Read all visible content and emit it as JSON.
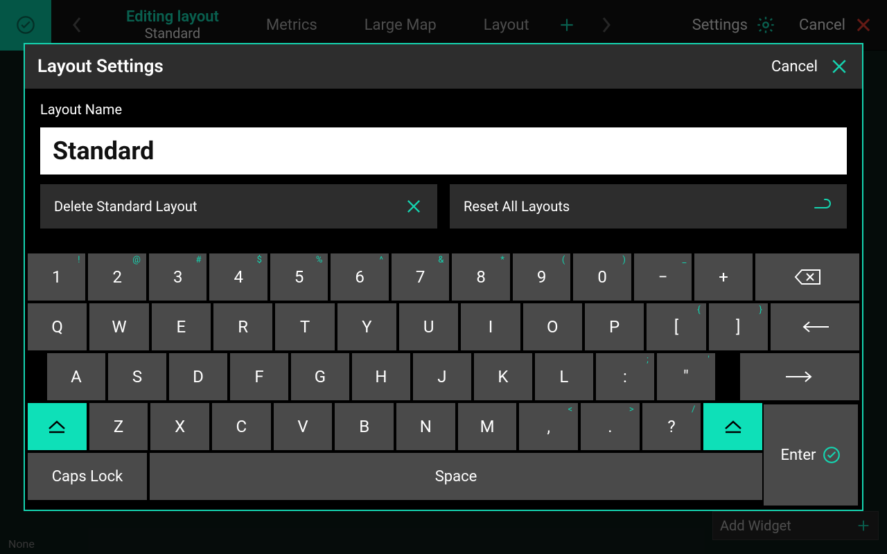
{
  "topbar": {
    "tabs": [
      {
        "title": "Editing layout",
        "sub": "Standard",
        "active": true
      },
      {
        "title": "Metrics"
      },
      {
        "title": "Large Map"
      },
      {
        "title": "Layout"
      }
    ],
    "settings": "Settings",
    "cancel": "Cancel"
  },
  "modal": {
    "title": "Layout Settings",
    "cancel": "Cancel",
    "name_label": "Layout Name",
    "name_value": "Standard",
    "delete_label": "Delete Standard Layout",
    "reset_label": "Reset All Layouts"
  },
  "keyboard": {
    "row1": [
      {
        "k": "1",
        "s": "!"
      },
      {
        "k": "2",
        "s": "@"
      },
      {
        "k": "3",
        "s": "#"
      },
      {
        "k": "4",
        "s": "$"
      },
      {
        "k": "5",
        "s": "%"
      },
      {
        "k": "6",
        "s": "^"
      },
      {
        "k": "7",
        "s": "&"
      },
      {
        "k": "8",
        "s": "*"
      },
      {
        "k": "9",
        "s": "("
      },
      {
        "k": "0",
        "s": ")"
      },
      {
        "k": "−",
        "s": "_"
      },
      {
        "k": "+"
      }
    ],
    "row2": [
      {
        "k": "Q"
      },
      {
        "k": "W"
      },
      {
        "k": "E"
      },
      {
        "k": "R"
      },
      {
        "k": "T"
      },
      {
        "k": "Y"
      },
      {
        "k": "U"
      },
      {
        "k": "I"
      },
      {
        "k": "O"
      },
      {
        "k": "P"
      },
      {
        "k": "[",
        "s": "{"
      },
      {
        "k": "]",
        "s": "}"
      }
    ],
    "row3": [
      {
        "k": "A"
      },
      {
        "k": "S"
      },
      {
        "k": "D"
      },
      {
        "k": "F"
      },
      {
        "k": "G"
      },
      {
        "k": "H"
      },
      {
        "k": "J"
      },
      {
        "k": "K"
      },
      {
        "k": "L"
      },
      {
        "k": ":",
        "s": ";"
      },
      {
        "k": "\"",
        "s": "'"
      }
    ],
    "row4": [
      {
        "k": "Z"
      },
      {
        "k": "X"
      },
      {
        "k": "C"
      },
      {
        "k": "V"
      },
      {
        "k": "B"
      },
      {
        "k": "N"
      },
      {
        "k": "M"
      },
      {
        "k": ",",
        "s": "<"
      },
      {
        "k": ".",
        "s": ">"
      },
      {
        "k": "?",
        "s": "/"
      }
    ],
    "caps": "Caps Lock",
    "space": "Space",
    "enter": "Enter"
  },
  "footer": {
    "add_widget": "Add Widget",
    "none": "None"
  }
}
